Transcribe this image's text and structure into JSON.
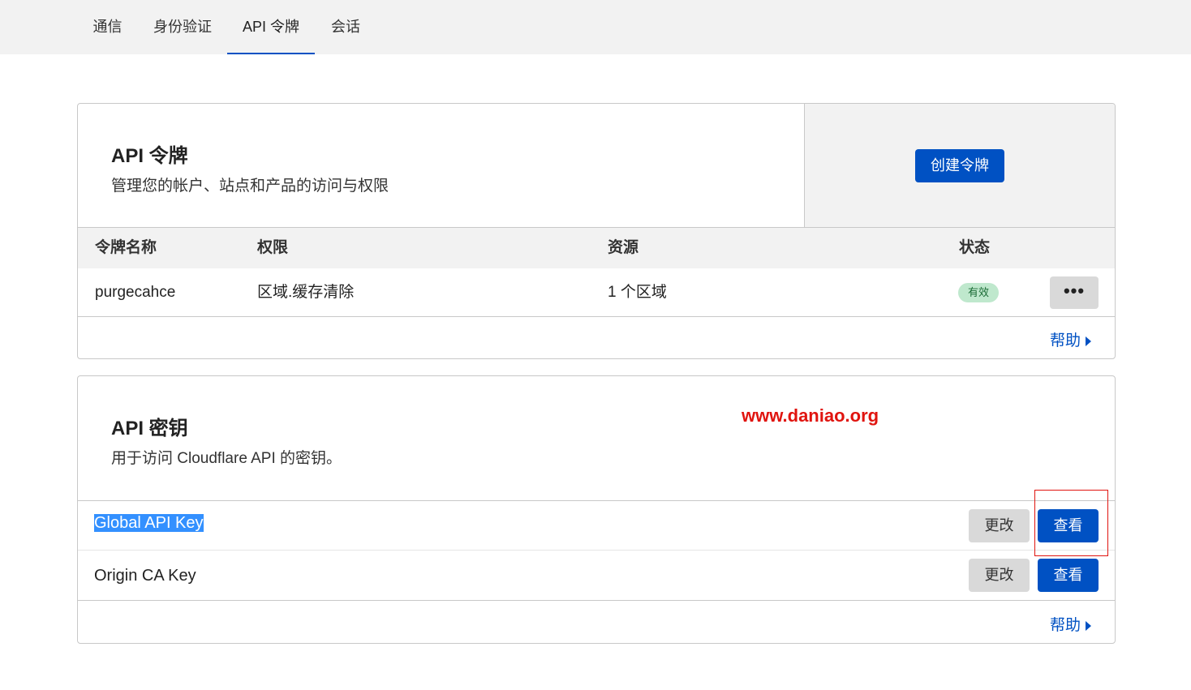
{
  "tabs": [
    {
      "label": "通信"
    },
    {
      "label": "身份验证"
    },
    {
      "label": "API 令牌"
    },
    {
      "label": "会话"
    }
  ],
  "api_tokens": {
    "title": "API 令牌",
    "description": "管理您的帐户、站点和产品的访问与权限",
    "create_button": "创建令牌",
    "columns": [
      "令牌名称",
      "权限",
      "资源",
      "状态"
    ],
    "rows": [
      {
        "name": "purgecahce",
        "permission": "区域.缓存清除",
        "resource": "1 个区域",
        "status": "有效",
        "more": "•••"
      }
    ],
    "help": "帮助"
  },
  "api_keys": {
    "title": "API 密钥",
    "description": "用于访问 Cloudflare API 的密钥。",
    "rows": [
      {
        "label": "Global API Key",
        "change": "更改",
        "view": "查看",
        "selected": true
      },
      {
        "label": "Origin CA Key",
        "change": "更改",
        "view": "查看",
        "selected": false
      }
    ],
    "help": "帮助"
  },
  "watermark": "www.daniao.org",
  "colors": {
    "primary": "#0051c3",
    "badge_bg": "#bfe8cd",
    "watermark": "#e0140f",
    "selection": "#3390ff"
  }
}
